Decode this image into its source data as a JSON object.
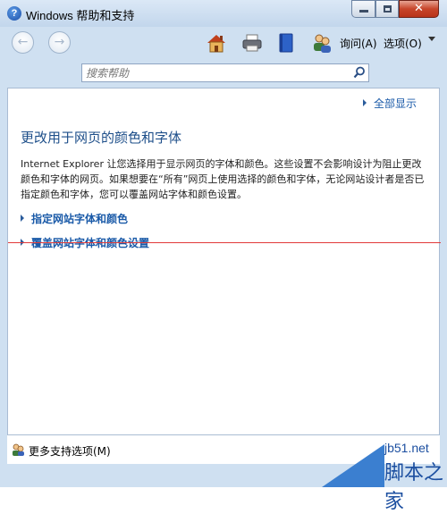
{
  "window": {
    "title": "Windows 帮助和支持"
  },
  "toolbar": {
    "ask_label": "询问(A)",
    "options_label": "选项(O)"
  },
  "search": {
    "placeholder": "搜索帮助"
  },
  "content": {
    "show_all": "全部显示",
    "heading": "更改用于网页的颜色和字体",
    "paragraph": "Internet Explorer 让您选择用于显示网页的字体和颜色。这些设置不会影响设计为阻止更改颜色和字体的网页。如果想要在“所有”网页上使用选择的颜色和字体，无论网站设计者是否已指定颜色和字体，您可以覆盖网站字体和颜色设置。",
    "links": [
      {
        "label": "指定网站字体和颜色"
      },
      {
        "label": "覆盖网站字体和颜色设置"
      }
    ]
  },
  "status": {
    "label": "更多支持选项(M)"
  },
  "watermark": {
    "site": "jb51.net",
    "name": "脚本之家"
  },
  "colors": {
    "accent": "#1a5aa8",
    "heading": "#1e4f8a",
    "frame": "#cfe0f1",
    "close": "#c7452a"
  },
  "icons": [
    "help-icon",
    "back-icon",
    "forward-icon",
    "home-icon",
    "print-icon",
    "browse-help-icon",
    "ask-icon",
    "search-icon",
    "support-icon"
  ]
}
